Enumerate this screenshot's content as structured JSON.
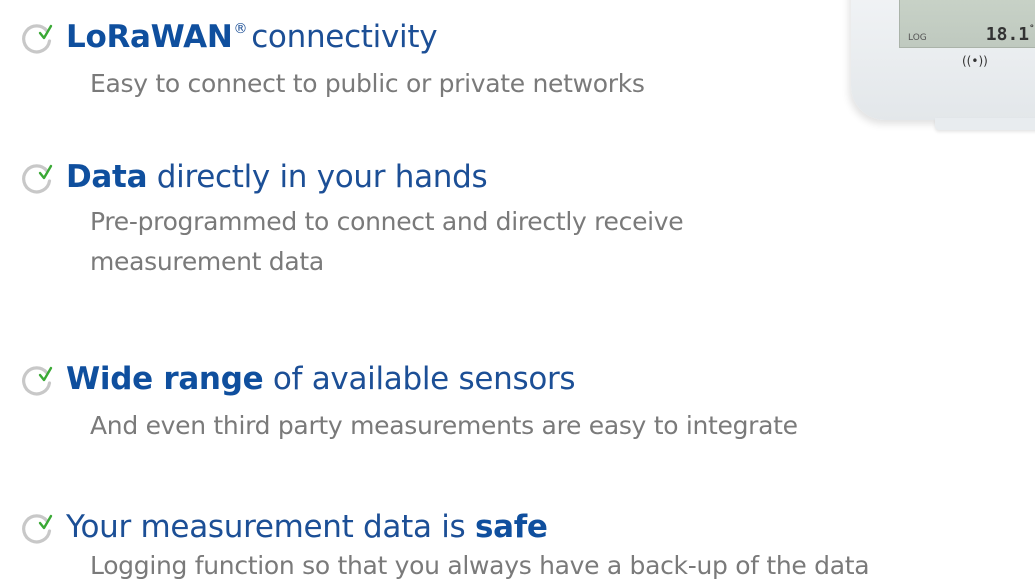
{
  "features": [
    {
      "title_highlight": "LoRaWAN",
      "title_sup": "®",
      "title_rest": "connectivity",
      "description": "Easy to connect to public or private networks"
    },
    {
      "title_highlight": "Data",
      "title_rest": " directly in your hands",
      "description": "Pre-programmed to connect and directly receive measurement data"
    },
    {
      "title_highlight": "Wide range",
      "title_rest": " of available sensors",
      "description": "And even third party measurements are easy to integrate"
    },
    {
      "title_prefix": "Your measurement data is ",
      "title_highlight": "safe",
      "description": "Logging function so that you always have a back-up of the data"
    }
  ],
  "device": {
    "screen_label": "LOG",
    "temperature": "18.1",
    "unit": "°C",
    "signal_symbol": "((•))"
  },
  "colors": {
    "accent_blue": "#0f4f9e",
    "description_gray": "#7a7a7a",
    "check_green": "#3aa935",
    "circle_gray": "#c8c8c8"
  },
  "icons": {
    "check": "check-circle-icon"
  }
}
